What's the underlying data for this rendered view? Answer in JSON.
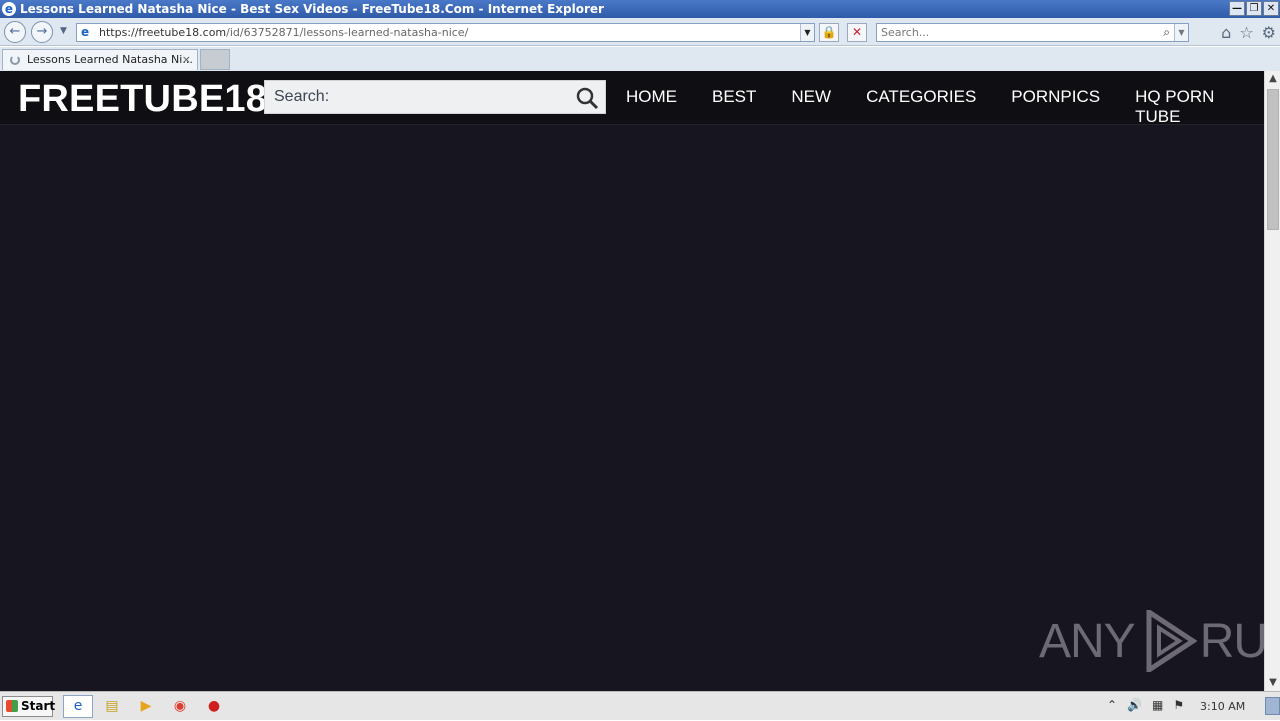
{
  "browser": {
    "window_title": "Lessons Learned Natasha Nice - Best Sex Videos - FreeTube18.Com - Internet Explorer",
    "url_primary": "https://freetube18.com",
    "url_path": "/id/63752871/lessons-learned-natasha-nice/",
    "search_placeholder": "Search...",
    "tab_title": "Lessons Learned Natasha Ni...",
    "icons": [
      "ie-logo-icon",
      "back-icon",
      "forward-icon",
      "lock-icon",
      "stop-icon",
      "search-icon",
      "home-icon",
      "favorites-star-icon",
      "settings-gear-icon",
      "close-icon"
    ]
  },
  "site": {
    "logo": "FREETUBE18",
    "search_placeholder": "Search:",
    "nav": [
      "HOME",
      "BEST",
      "NEW",
      "CATEGORIES",
      "PORNPICS",
      "HQ PORN TUBE"
    ],
    "colors": {
      "background": "#171520",
      "header": "#0f0f13",
      "text": "#ffffff"
    }
  },
  "watermark": {
    "left": "ANY",
    "right": "RUN"
  },
  "taskbar": {
    "start_label": "Start",
    "clock": "3:10 AM",
    "apps": [
      "internet-explorer-icon",
      "file-explorer-icon",
      "media-player-icon",
      "chrome-icon",
      "stop-sign-icon"
    ]
  }
}
